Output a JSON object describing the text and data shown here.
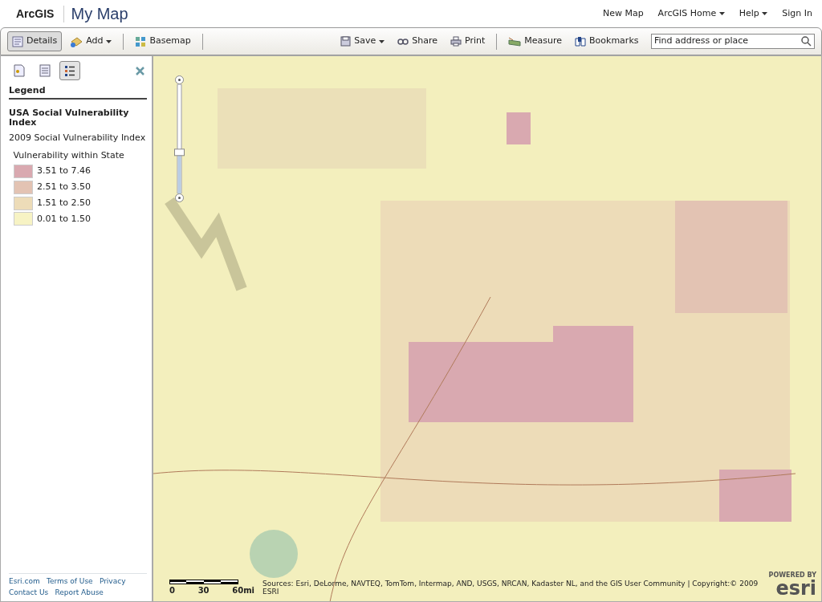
{
  "header": {
    "brand": "ArcGIS",
    "title": "My Map",
    "links": [
      {
        "label": "New Map",
        "dropdown": false
      },
      {
        "label": "ArcGIS Home",
        "dropdown": true
      },
      {
        "label": "Help",
        "dropdown": true
      },
      {
        "label": "Sign In",
        "dropdown": false
      }
    ]
  },
  "toolbar": {
    "left": [
      {
        "label": "Details",
        "dropdown": false,
        "selected": true
      },
      {
        "label": "Add",
        "dropdown": true,
        "selected": false
      },
      {
        "label": "Basemap",
        "dropdown": false,
        "selected": false
      }
    ],
    "right": [
      {
        "label": "Save",
        "dropdown": true
      },
      {
        "label": "Share",
        "dropdown": false
      },
      {
        "label": "Print",
        "dropdown": false
      },
      {
        "label": "Measure",
        "dropdown": false
      },
      {
        "label": "Bookmarks",
        "dropdown": false
      }
    ],
    "search": {
      "placeholder": "Find address or place"
    }
  },
  "panel": {
    "tabs": [
      {
        "selected": false
      },
      {
        "selected": false
      },
      {
        "selected": true
      }
    ],
    "heading": "Legend",
    "layer": "USA Social Vulnerability Index",
    "sublayer": "2009 Social Vulnerability Index",
    "field": "Vulnerability within State",
    "classes": [
      {
        "label": "3.51 to 7.46",
        "color": "#d9a9b0"
      },
      {
        "label": "2.51 to 3.50",
        "color": "#e3c3b3"
      },
      {
        "label": "1.51 to 2.50",
        "color": "#eddcb8"
      },
      {
        "label": "0.01 to 1.50",
        "color": "#f7f3c4"
      }
    ],
    "footer_links": [
      [
        "Esri.com",
        "Terms of Use",
        "Privacy"
      ],
      [
        "Contact Us",
        "Report Abuse"
      ]
    ]
  },
  "map": {
    "zoom": {
      "level": 0.4
    },
    "scale": [
      "0",
      "30",
      "60mi"
    ],
    "attribution": [
      "Sources: Esri, DeLorme, NAVTEQ, TomTom, Intermap, AND, USGS, NRCAN, Kadaster NL, and the GIS User Community | Copyright:© 2009",
      "ESRI"
    ],
    "logo": {
      "small": "POWERED BY",
      "big": "esri"
    }
  }
}
